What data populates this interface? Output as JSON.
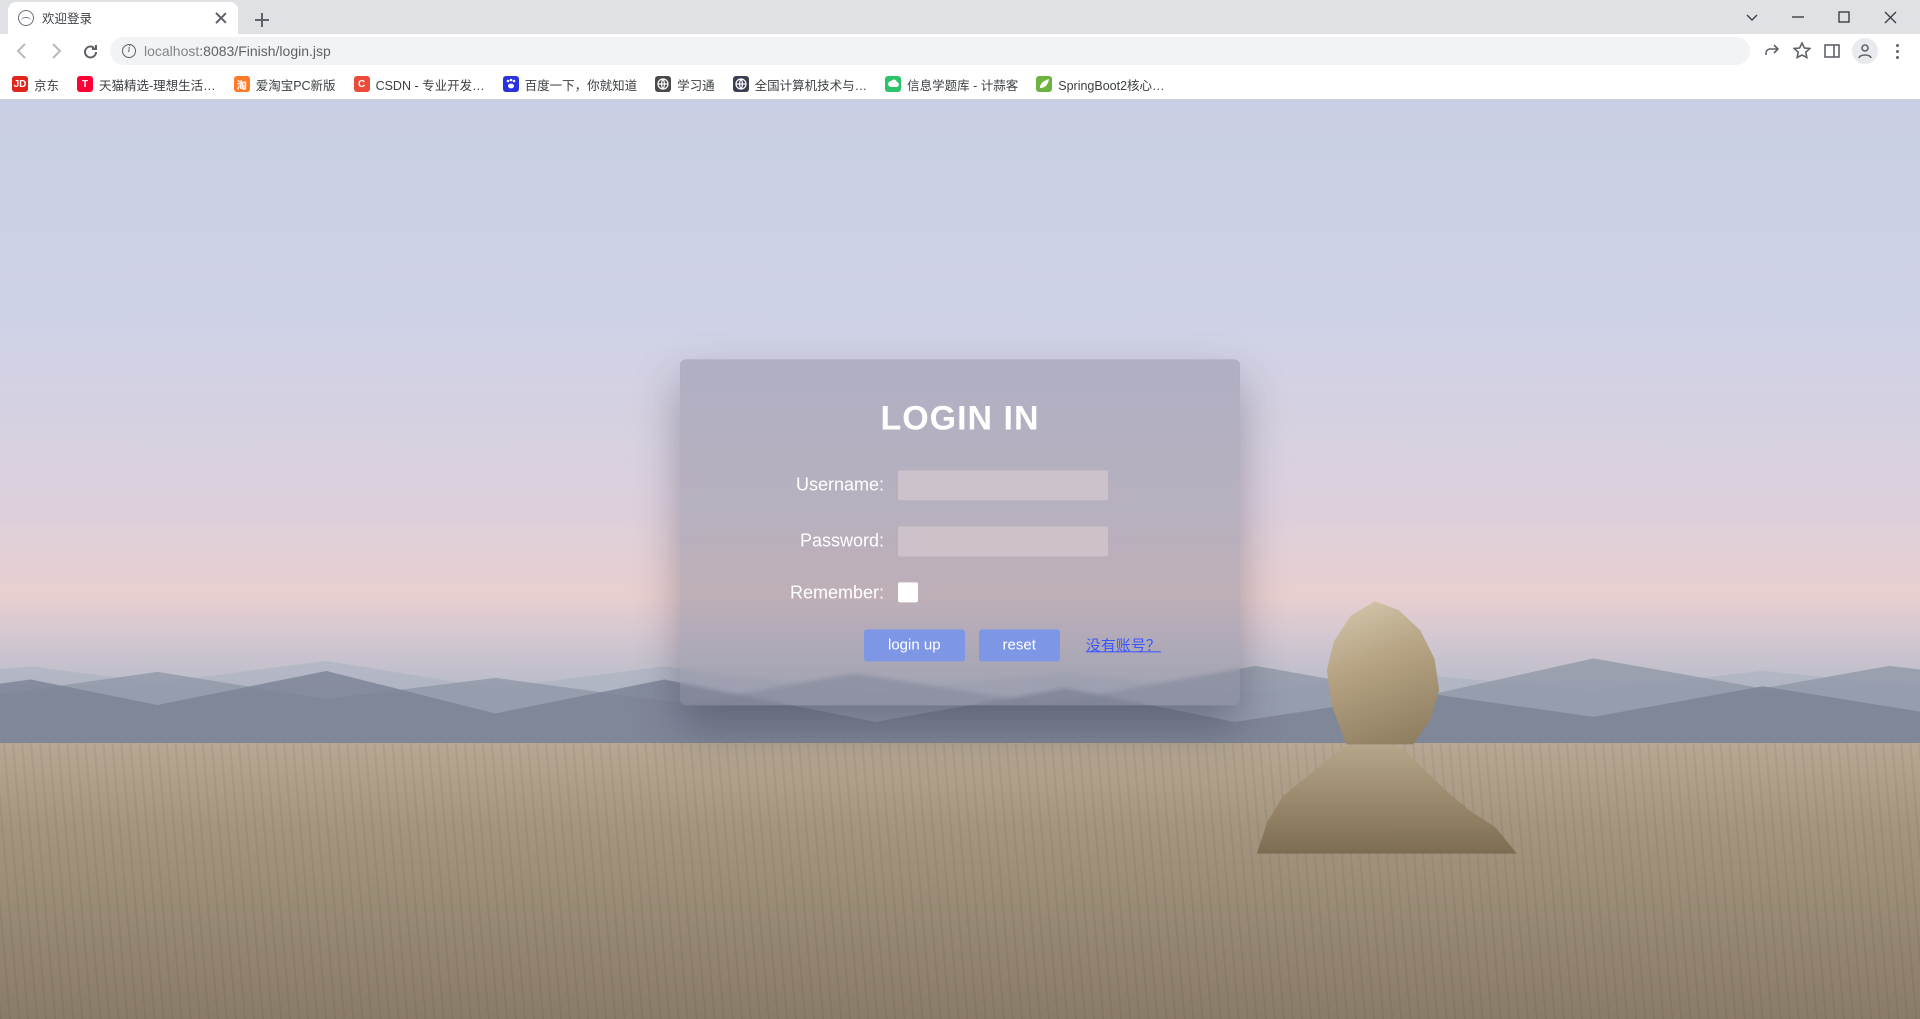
{
  "browser": {
    "tab_title": "欢迎登录",
    "url_host_dim": "localhost",
    "url_rest": ":8083/Finish/login.jsp"
  },
  "bookmarks": [
    {
      "label": "京东",
      "icon_text": "JD",
      "icon_bg": "#e1251b"
    },
    {
      "label": "天猫精选-理想生活…",
      "icon_text": "T",
      "icon_bg": "#ff0036"
    },
    {
      "label": "爱淘宝PC新版",
      "icon_text": "淘",
      "icon_bg": "#ff7a29"
    },
    {
      "label": "CSDN - 专业开发…",
      "icon_text": "C",
      "icon_bg": "#ec4b3a"
    },
    {
      "label": "百度一下，你就知道",
      "icon_text": "",
      "icon_bg": "#2932e1",
      "paw": true
    },
    {
      "label": "学习通",
      "icon_text": "",
      "icon_bg": "#4a4a4a",
      "globe": true
    },
    {
      "label": "全国计算机技术与…",
      "icon_text": "",
      "icon_bg": "#3a3e52",
      "globe": true
    },
    {
      "label": "信息学题库 - 计蒜客",
      "icon_text": "",
      "icon_bg": "#2cc36b",
      "cloud": true
    },
    {
      "label": "SpringBoot2核心…",
      "icon_text": "",
      "icon_bg": "#6db33f",
      "leaf": true
    }
  ],
  "login": {
    "title": "LOGIN IN",
    "username_label": "Username:",
    "password_label": "Password:",
    "remember_label": "Remember:",
    "login_button": "login up",
    "reset_button": "reset",
    "no_account_link": "没有账号？"
  }
}
